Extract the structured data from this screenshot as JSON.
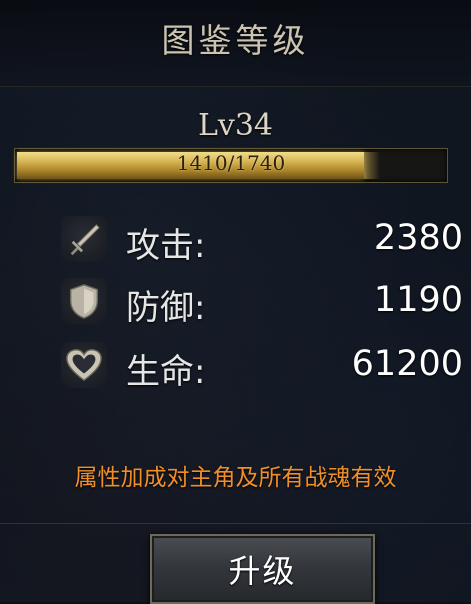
{
  "header": {
    "title": "图鉴等级"
  },
  "level": {
    "label": "Lv34",
    "progress_text": "1410/1740",
    "current": 1410,
    "max": 1740,
    "bar_color": "#d7b554"
  },
  "stats": [
    {
      "icon": "sword-icon",
      "label": "攻击:",
      "value": "2380"
    },
    {
      "icon": "shield-icon",
      "label": "防御:",
      "value": "1190"
    },
    {
      "icon": "heart-icon",
      "label": "生命:",
      "value": "61200"
    }
  ],
  "note": {
    "text": "属性加成对主角及所有战魂有效",
    "color": "#f08e2a"
  },
  "actions": {
    "upgrade_label": "升级"
  }
}
